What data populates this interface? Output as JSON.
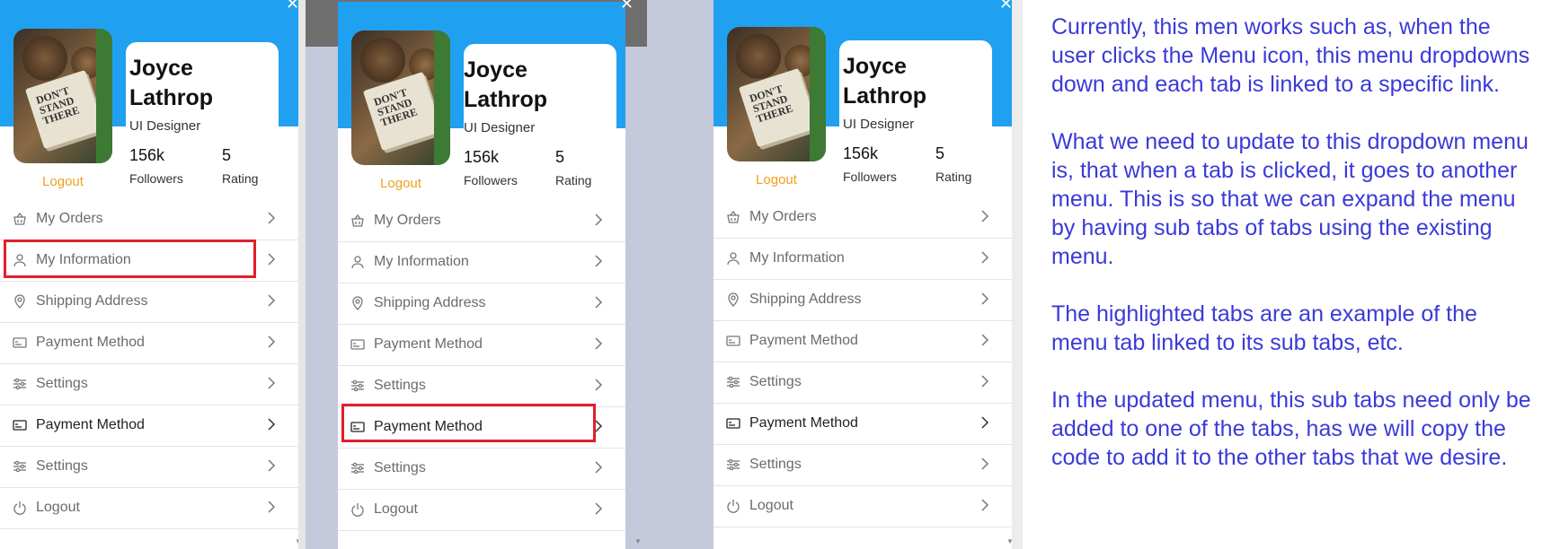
{
  "profile": {
    "name_line1": "Joyce",
    "name_line2": "Lathrop",
    "role": "UI Designer",
    "followers_count": "156k",
    "followers_label": "Followers",
    "rating_value": "5",
    "rating_label": "Rating",
    "logout_link": "Logout",
    "avatar_text": "DON'T\nSTAND\nTHERE"
  },
  "menu": [
    {
      "label": "My Orders",
      "icon": "basket-icon"
    },
    {
      "label": "My Information",
      "icon": "user-icon"
    },
    {
      "label": "Shipping Address",
      "icon": "location-pin-icon"
    },
    {
      "label": "Payment Method",
      "icon": "card-icon"
    },
    {
      "label": "Settings",
      "icon": "sliders-icon"
    },
    {
      "label": "Payment Method",
      "icon": "card-icon"
    },
    {
      "label": "Settings",
      "icon": "sliders-icon"
    },
    {
      "label": "Logout",
      "icon": "power-icon"
    }
  ],
  "highlights": {
    "panel1_item": "My Information",
    "panel2_item": "Payment Method",
    "color": "#e0202c"
  },
  "colors": {
    "accent_blue": "#20a0f0",
    "logout_orange": "#f0a020",
    "note_text": "#3a3ad8",
    "side_gray": "#c5c9dc"
  },
  "note": {
    "p1": "Currently, this men works such as, when the user clicks the Menu icon, this menu dropdowns down and each tab is linked to a specific link.",
    "p2": "What we need to update to this dropdown menu is, that when a tab is clicked, it goes to another menu. This is so that we can expand the menu by having sub tabs of tabs using the existing menu.",
    "p3": "The highlighted tabs are an example of the menu tab linked to its sub tabs, etc.",
    "p4": "In the updated menu, this sub tabs need only be added to one of the tabs, has we will copy the code to add it to the other tabs that we desire."
  }
}
